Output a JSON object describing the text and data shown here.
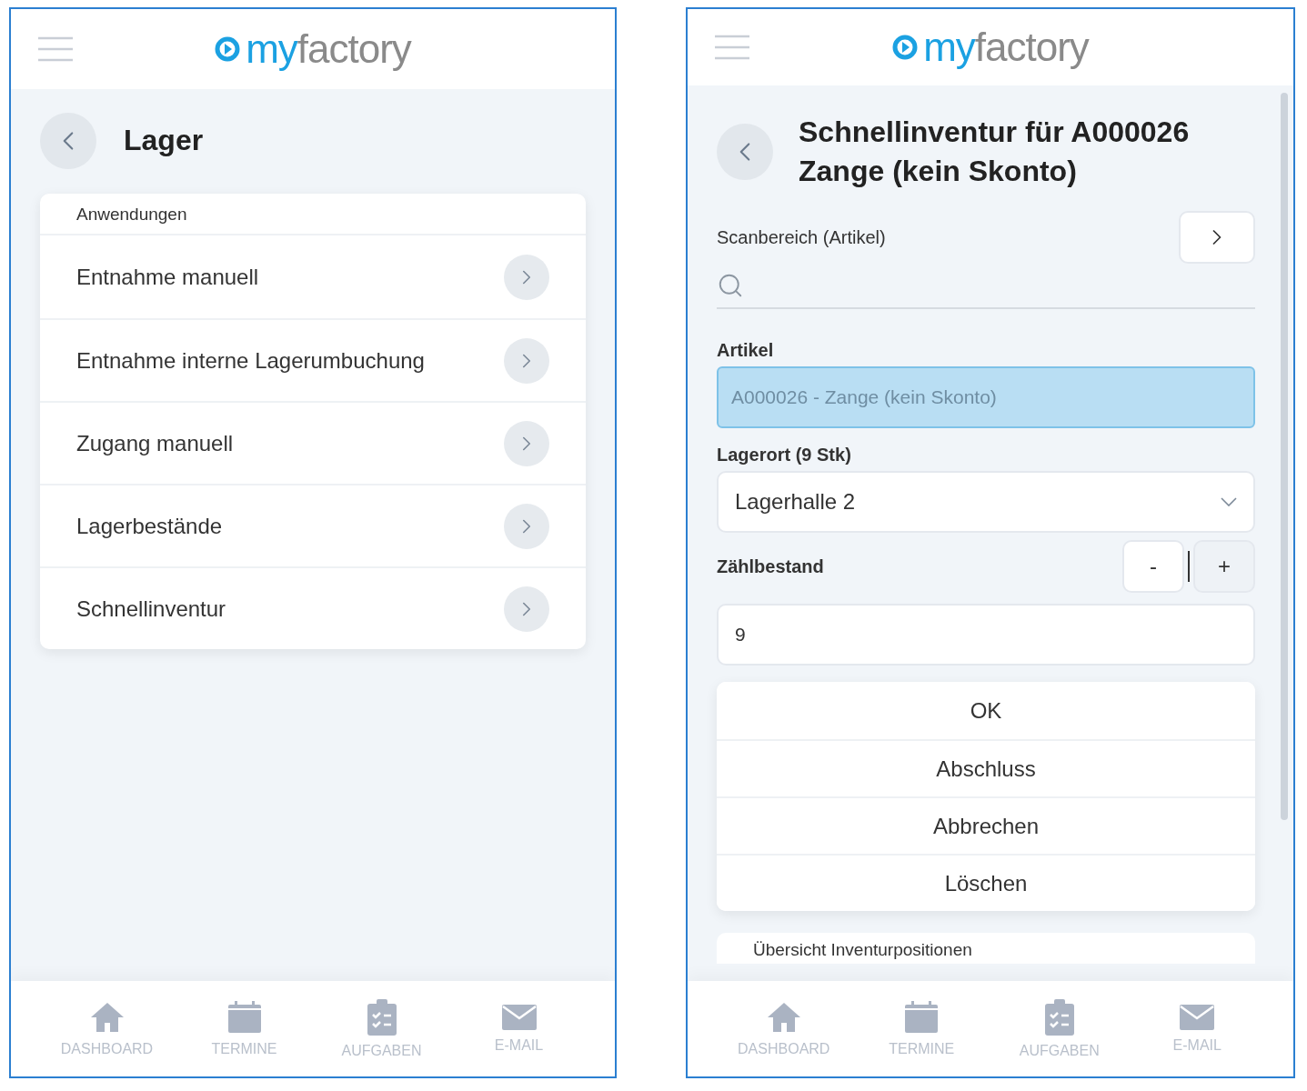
{
  "screens": [
    {
      "kind": "menu",
      "logo": {
        "accent": "my",
        "rest": "factory"
      },
      "title": "Lager",
      "section_label": "Anwendungen",
      "items": [
        "Entnahme manuell",
        "Entnahme interne Lagerumbuchung",
        "Zugang manuell",
        "Lagerbestände",
        "Schnellinventur"
      ],
      "nav": [
        "DASHBOARD",
        "TERMINE",
        "AUFGABEN",
        "E-MAIL"
      ]
    },
    {
      "kind": "form",
      "logo": {
        "accent": "my",
        "rest": "factory"
      },
      "title": "Schnellinventur für A000026 Zange (kein Skonto)",
      "scan": {
        "label": "Scanbereich (Artikel)"
      },
      "article": {
        "label": "Artikel",
        "value": "A000026 - Zange (kein Skonto)"
      },
      "location": {
        "label": "Lagerort (9 Stk)",
        "value": "Lagerhalle 2"
      },
      "count": {
        "label": "Zählbestand",
        "value": "9",
        "buttons": [
          "-",
          "+"
        ]
      },
      "actions": [
        "OK",
        "Abschluss",
        "Abbrechen",
        "Löschen"
      ],
      "overview": "Übersicht Inventurpositionen",
      "nav": [
        "DASHBOARD",
        "TERMINE",
        "AUFGABEN",
        "E-MAIL"
      ]
    }
  ]
}
